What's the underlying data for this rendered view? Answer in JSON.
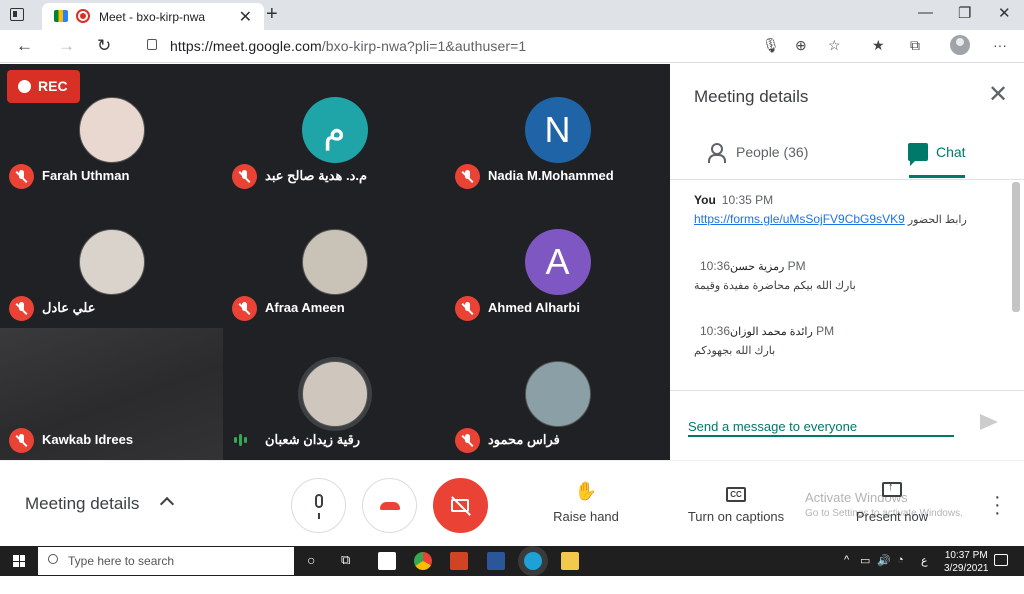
{
  "browser": {
    "tab_title": "Meet - bxo-kirp-nwa",
    "url_host": "https://meet.google.com",
    "url_path": "/bxo-kirp-nwa?pli=1&authuser=1"
  },
  "recording_label": "REC",
  "participants": [
    {
      "name": "Farah Uthman",
      "avatar": "photo",
      "initial": "",
      "color": "#e8d8d0",
      "muted": true
    },
    {
      "name": "م.د. هدية صالح عبد",
      "avatar": "letter",
      "initial": "م",
      "color": "#1fa5a8",
      "muted": true
    },
    {
      "name": "Nadia M.Mohammed",
      "avatar": "letter",
      "initial": "N",
      "color": "#1f64a6",
      "muted": true
    },
    {
      "name": "علي عادل",
      "avatar": "photo",
      "initial": "",
      "color": "#d9d3cc",
      "muted": true
    },
    {
      "name": "Afraa Ameen",
      "avatar": "photo",
      "initial": "",
      "color": "#c9c2b6",
      "muted": true
    },
    {
      "name": "Ahmed Alharbi",
      "avatar": "letter",
      "initial": "A",
      "color": "#7e57c2",
      "muted": true
    },
    {
      "name": "Kawkab Idrees",
      "avatar": "video",
      "initial": "",
      "color": "#333335",
      "muted": true
    },
    {
      "name": "رقية زيدان شعبان",
      "avatar": "photo",
      "initial": "",
      "color": "#cfc6bd",
      "muted": false
    },
    {
      "name": "فراس محمود",
      "avatar": "photo",
      "initial": "",
      "color": "#8aa0a6",
      "muted": true
    }
  ],
  "panel": {
    "title": "Meeting details",
    "tab_people": "People (36)",
    "tab_chat": "Chat",
    "messages": [
      {
        "sender": "You",
        "time": "10:35 PM",
        "text": "رابط الحضور",
        "link": "https://forms.gle/uMsSojFV9CbG9sVK9"
      },
      {
        "sender": "رمزية حسن",
        "time": "10:36 PM",
        "text": "بارك الله بيكم محاضرة مفيدة وقيمة",
        "link": ""
      },
      {
        "sender": "رائدة محمد الوزان",
        "time": "10:36 PM",
        "text": "بارك الله بجهودكم",
        "link": ""
      }
    ],
    "input_placeholder": "Send a message to everyone"
  },
  "bottom_bar": {
    "meeting_details": "Meeting details",
    "raise_hand": "Raise hand",
    "captions": "Turn on captions",
    "present": "Present now",
    "watermark_title": "Activate Windows",
    "watermark_sub": "Go to Settings to activate Windows."
  },
  "taskbar": {
    "search_placeholder": "Type here to search",
    "time": "10:37 PM",
    "date": "3/29/2021",
    "lang": "ع"
  }
}
